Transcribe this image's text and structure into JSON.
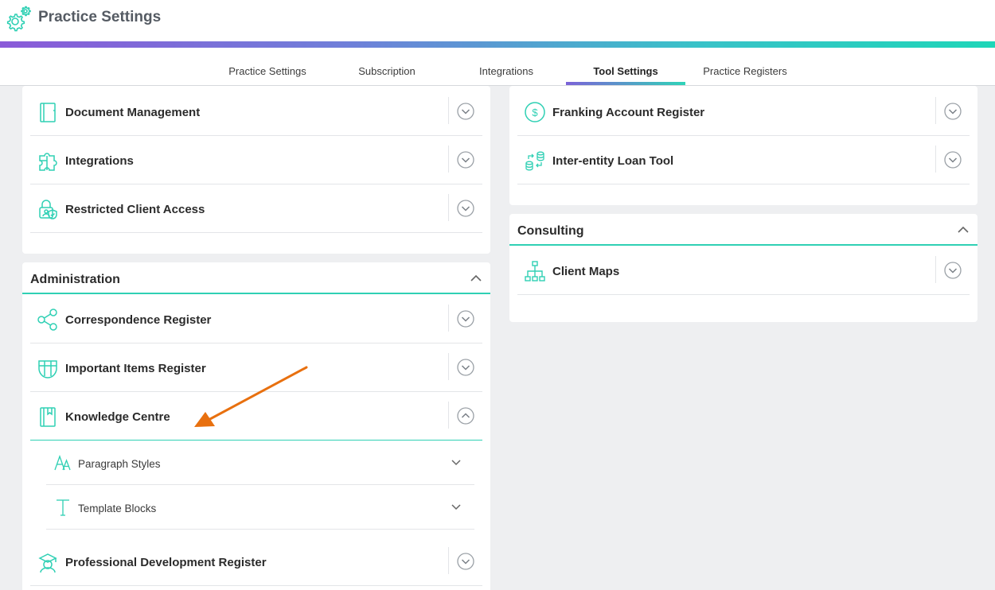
{
  "app": {
    "title": "Practice Settings"
  },
  "tabs": [
    {
      "label": "Practice Settings"
    },
    {
      "label": "Subscription"
    },
    {
      "label": "Integrations"
    },
    {
      "label": "Tool Settings",
      "active": true
    },
    {
      "label": "Practice Registers"
    }
  ],
  "left_top_card": {
    "items": [
      {
        "label": "Document Management",
        "icon": "book-icon"
      },
      {
        "label": "Integrations",
        "icon": "puzzle-icon"
      },
      {
        "label": "Restricted Client Access",
        "icon": "user-lock-icon"
      }
    ]
  },
  "administration": {
    "title": "Administration",
    "items": [
      {
        "label": "Correspondence Register",
        "icon": "share-icon"
      },
      {
        "label": "Important Items Register",
        "icon": "shield-icon"
      },
      {
        "label": "Knowledge Centre",
        "icon": "bookmark-book-icon",
        "expanded": true
      },
      {
        "label": "Professional Development Register",
        "icon": "graduate-icon"
      }
    ],
    "knowledge_centre_subitems": [
      {
        "label": "Paragraph Styles",
        "icon": "font-icon"
      },
      {
        "label": "Template Blocks",
        "icon": "text-t-icon"
      }
    ]
  },
  "right_top_card": {
    "items": [
      {
        "label": "Franking Account Register",
        "icon": "dollar-circle-icon"
      },
      {
        "label": "Inter-entity Loan Tool",
        "icon": "database-transfer-icon"
      }
    ]
  },
  "consulting": {
    "title": "Consulting",
    "items": [
      {
        "label": "Client Maps",
        "icon": "org-chart-icon"
      }
    ]
  },
  "colors": {
    "accent": "#2fd0b4",
    "arrow": "#e8700f",
    "gradient_start": "#8a5ad8",
    "gradient_end": "#1ed6b8"
  }
}
